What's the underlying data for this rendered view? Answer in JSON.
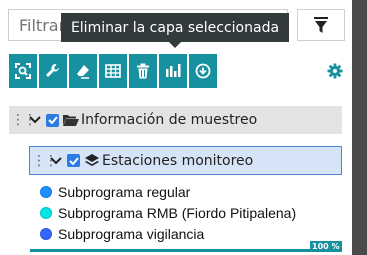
{
  "filter": {
    "placeholder": "Filtrar"
  },
  "tooltip": {
    "text": "Eliminar la capa seleccionada"
  },
  "toolbar": {
    "color": "#17919f",
    "buttons": [
      "crosshair-icon",
      "wrench-icon",
      "eraser-icon",
      "table-icon",
      "trash-icon",
      "bar-chart-icon",
      "download-icon"
    ]
  },
  "tree": {
    "group": {
      "label": "Información de muestreo",
      "checked": true
    },
    "layer": {
      "label": "Estaciones monitoreo",
      "checked": true,
      "legend": [
        {
          "label": "Subprograma regular",
          "color": "#1e90ff"
        },
        {
          "label": "Subprograma RMB (Fiordo Pitipalena)",
          "color": "#00e5e5"
        },
        {
          "label": "Subprograma vigilancia",
          "color": "#3366ff"
        }
      ],
      "progress": {
        "value": 100,
        "label": "100 %"
      }
    }
  }
}
